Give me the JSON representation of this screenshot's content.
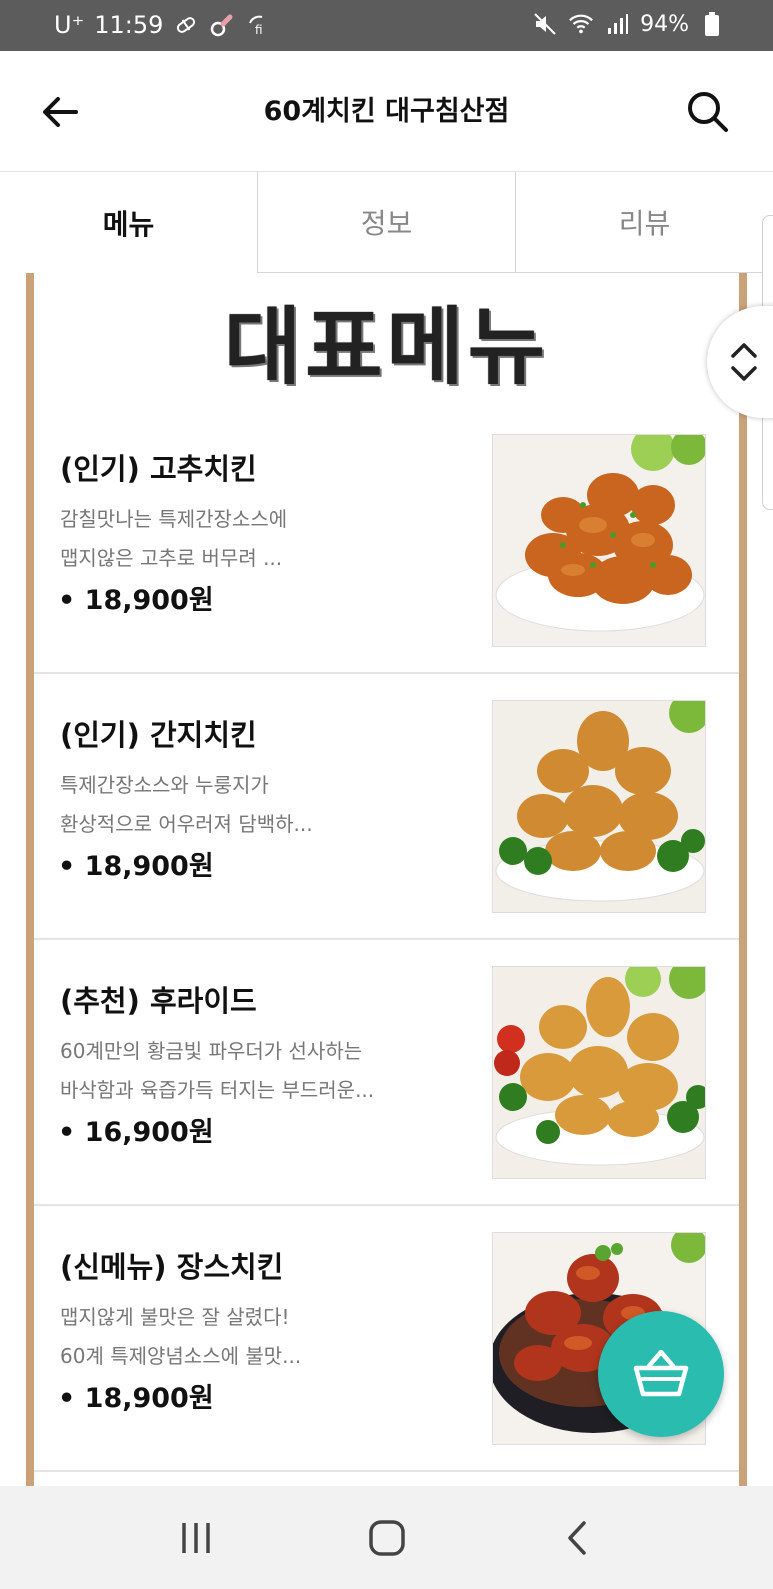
{
  "status_bar": {
    "carrier": "U⁺",
    "time": "11:59",
    "battery": "94%",
    "icons": [
      "pill-icon",
      "pacifier-icon",
      "wifi-calling-icon",
      "mute-icon",
      "wifi-icon",
      "signal-icon",
      "battery-icon"
    ]
  },
  "header": {
    "title": "60계치킨 대구침산점",
    "back_icon": "arrow-left-icon",
    "search_icon": "search-icon"
  },
  "tabs": [
    {
      "label": "메뉴",
      "active": true
    },
    {
      "label": "정보",
      "active": false
    },
    {
      "label": "리뷰",
      "active": false
    }
  ],
  "section": {
    "title": "대표메뉴"
  },
  "menu_items": [
    {
      "name": "(인기) 고추치킨",
      "desc_line1": "감칠맛나는 특제간장소스에",
      "desc_line2": "맵지않은 고추로 버무려  ...",
      "price": "• 18,900원",
      "photo": "fried-chicken-with-green-chili"
    },
    {
      "name": "(인기) 간지치킨",
      "desc_line1": "특제간장소스와 누룽지가",
      "desc_line2": "환상적으로 어우러져 담백하...",
      "price": "• 18,900원",
      "photo": "soy-glazed-chicken-with-broccoli"
    },
    {
      "name": "(추천) 후라이드",
      "desc_line1": "60계만의 황금빛 파우더가 선사하는",
      "desc_line2": "바삭함과 육즙가득 터지는 부드러운...",
      "price": "• 16,900원",
      "photo": "golden-fried-chicken"
    },
    {
      "name": "(신메뉴) 장스치킨",
      "desc_line1": "맵지않게 불맛은 잘 살렸다!",
      "desc_line2": "60계 특제양념소스에 불맛...",
      "price": "• 18,900원",
      "photo": "red-sauce-chicken-on-black-plate"
    }
  ],
  "floating": {
    "scroll_icon": "chevron-up-down-icon",
    "cart_icon": "basket-icon"
  },
  "nav_bar": {
    "icons": [
      "recent-apps-icon",
      "home-icon",
      "back-chevron-icon"
    ]
  },
  "colors": {
    "accent_border": "#c9a27a",
    "cart_button": "#2bbcb0",
    "status_bar": "#5c5c5c"
  }
}
